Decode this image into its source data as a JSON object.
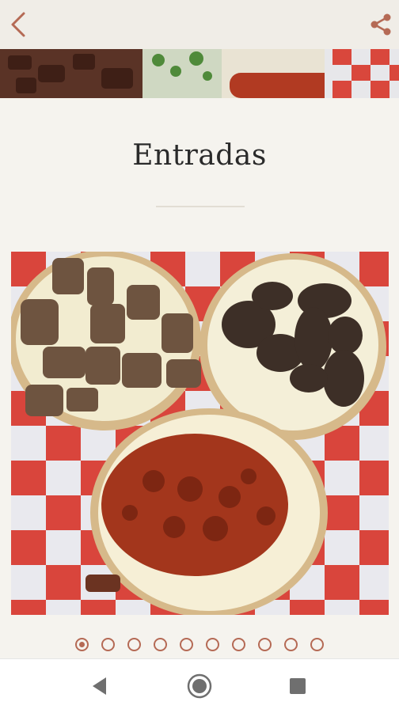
{
  "header": {
    "back_icon": "chevron-left-icon",
    "share_icon": "share-icon",
    "accent_color": "#b56a55"
  },
  "section": {
    "title": "Entradas"
  },
  "gallery": {
    "photo_description_icon": "photo",
    "total_slides": 10,
    "active_index": 0
  },
  "system_nav": {
    "back_icon": "triangle-back-icon",
    "home_icon": "circle-home-icon",
    "recents_icon": "square-recents-icon"
  }
}
